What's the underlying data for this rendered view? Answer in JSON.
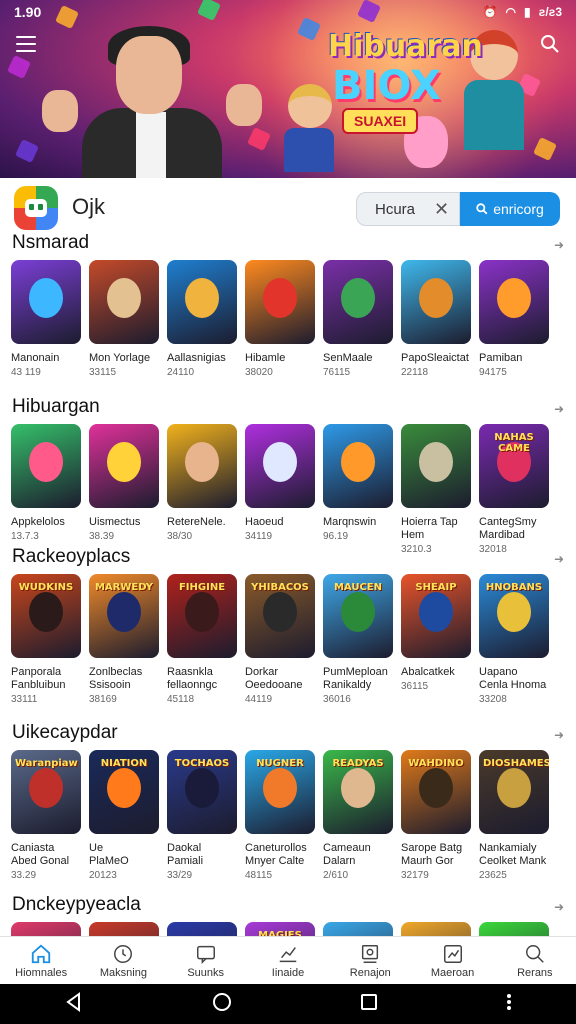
{
  "status_bar": {
    "time": "1.90",
    "battery_text": "ƨ/ƨ3"
  },
  "banner": {
    "logo_line1": "Hibuaran",
    "logo_line2": "BIOX",
    "logo_plate": "SUAXEI"
  },
  "header": {
    "app_name": "Ojk",
    "search_value": "Hcura",
    "search_button_label": "enricorg"
  },
  "sections": [
    {
      "title": "Nsmarad",
      "items": [
        {
          "line1": "Manonain",
          "line2": "",
          "meta": "43 119",
          "art": "",
          "bg": "#7b3fd6",
          "fig": "#3db7ff"
        },
        {
          "line1": "Mon Yorlage",
          "line2": "",
          "meta": "33115",
          "art": "",
          "bg": "#c44a2a",
          "fig": "#e3c190"
        },
        {
          "line1": "Aallasnigias",
          "line2": "",
          "meta": "24110",
          "art": "",
          "bg": "#1f7fd0",
          "fig": "#f0b33e"
        },
        {
          "line1": "Hibamle",
          "line2": "",
          "meta": "38020",
          "art": "",
          "bg": "#ff8a1f",
          "fig": "#e2342a"
        },
        {
          "line1": "SenMaale",
          "line2": "",
          "meta": "76115",
          "art": "",
          "bg": "#7a2fa8",
          "fig": "#3aa655"
        },
        {
          "line1": "PapoSleaictat",
          "line2": "",
          "meta": "22118",
          "art": "",
          "bg": "#3fb8ec",
          "fig": "#e38c2c"
        },
        {
          "line1": "Pamiban",
          "line2": "",
          "meta": "94175",
          "art": "",
          "bg": "#8a32c8",
          "fig": "#ff9c2b"
        }
      ]
    },
    {
      "title": "Hibuargan",
      "items": [
        {
          "line1": "Appkelolos",
          "line2": "",
          "meta": "13.7.3",
          "art": "",
          "bg": "#35c06a",
          "fig": "#ff5a8a"
        },
        {
          "line1": "Uismectus",
          "line2": "",
          "meta": "38.39",
          "art": "",
          "bg": "#e0319a",
          "fig": "#ffd23a"
        },
        {
          "line1": "RetereNele.",
          "line2": "",
          "meta": "38/30",
          "art": "",
          "bg": "#f2b21c",
          "fig": "#e7b48e"
        },
        {
          "line1": "Haoeud",
          "line2": "",
          "meta": "34119",
          "art": "",
          "bg": "#b02fe0",
          "fig": "#dfe8ff"
        },
        {
          "line1": "Marqnswin",
          "line2": "",
          "meta": "96.19",
          "art": "",
          "bg": "#2e9ae8",
          "fig": "#ff9a2a"
        },
        {
          "line1": "Hoierra Tap",
          "line2": "Hem",
          "meta": "3210.3",
          "art": "",
          "bg": "#3a8c3c",
          "fig": "#c8c0a0"
        },
        {
          "line1": "CantegSmy",
          "line2": "Mardibad",
          "meta": "32018",
          "art": "NAHAS CAME",
          "bg": "#7a2ab0",
          "fig": "#e03060"
        }
      ]
    },
    {
      "title": "Rackeoyplacs",
      "items": [
        {
          "line1": "Panporala",
          "line2": "Fanbluibun",
          "meta": "33111",
          "art": "WUDKINS",
          "bg": "#c8461c",
          "fig": "#2a1a1a"
        },
        {
          "line1": "Zonlbeclas",
          "line2": "Ssisooin",
          "meta": "38169",
          "art": "MARWEDY",
          "bg": "#f08a2a",
          "fig": "#1e2a6a"
        },
        {
          "line1": "Raasnkla",
          "line2": "fellaonngc",
          "meta": "45118",
          "art": "FIHGINE",
          "bg": "#b0221c",
          "fig": "#3a1a1a"
        },
        {
          "line1": "Dorkar",
          "line2": "Oeedooane",
          "meta": "44119",
          "art": "YHIBACOS",
          "bg": "#8a5a2a",
          "fig": "#2a2a2a"
        },
        {
          "line1": "PumMeploan",
          "line2": "Ranikaldy",
          "meta": "36016",
          "art": "MAUCEN",
          "bg": "#3fa8e8",
          "fig": "#2a8a3a"
        },
        {
          "line1": "Abalcatkek",
          "line2": "",
          "meta": "36115",
          "art": "SHEAIP",
          "bg": "#e8542a",
          "fig": "#1e4aa0"
        },
        {
          "line1": "Uapano",
          "line2": "Cenla Hnoma",
          "meta": "33208",
          "art": "HNOBANS",
          "bg": "#2a8ad8",
          "fig": "#e8c03a"
        }
      ]
    },
    {
      "title": "Uikecaypdar",
      "items": [
        {
          "line1": "Caniasta",
          "line2": "Abed Gonal",
          "meta": "33.29",
          "art": "Waranpiaw",
          "bg": "#5a6a8a",
          "fig": "#c0302a"
        },
        {
          "line1": "Ue",
          "line2": "PlaMeO",
          "meta": "20123",
          "art": "NIATION",
          "bg": "#1a2a5a",
          "fig": "#ff7a1a"
        },
        {
          "line1": "Daokal",
          "line2": "Pamiali",
          "meta": "33/29",
          "art": "TOCHAOS",
          "bg": "#2a3a8a",
          "fig": "#1a1a3a"
        },
        {
          "line1": "Caneturollos",
          "line2": "Mnyer Calte",
          "meta": "48115",
          "art": "NUGNER",
          "bg": "#2aa8e8",
          "fig": "#f07a2a"
        },
        {
          "line1": "Cameaun",
          "line2": "Dalarn",
          "meta": "2/610",
          "art": "READYAS",
          "bg": "#3ab84a",
          "fig": "#e0b890"
        },
        {
          "line1": "Sarope Batg",
          "line2": "Maurh Gor",
          "meta": "32179",
          "art": "WAHDINO",
          "bg": "#e07a1a",
          "fig": "#3a2a1a"
        },
        {
          "line1": "Nankamialy",
          "line2": "Ceolket Mank",
          "meta": "23625",
          "art": "DIOSHAMES",
          "bg": "#4a3a2a",
          "fig": "#c8a040"
        }
      ]
    },
    {
      "title": "Dnckeypyeacla",
      "items": [
        {
          "line1": "",
          "line2": "",
          "meta": "",
          "art": "",
          "bg": "#e03a6a",
          "fig": "#3a6ad8"
        },
        {
          "line1": "",
          "line2": "",
          "meta": "",
          "art": "",
          "bg": "#c83a2a",
          "fig": "#1a2a5a"
        },
        {
          "line1": "",
          "line2": "",
          "meta": "",
          "art": "",
          "bg": "#2a3aa8",
          "fig": "#3ad8e0"
        },
        {
          "line1": "",
          "line2": "",
          "meta": "",
          "art": "MAGIES",
          "bg": "#a83ad8",
          "fig": "#f0d03a"
        },
        {
          "line1": "",
          "line2": "",
          "meta": "",
          "art": "",
          "bg": "#3aa8e8",
          "fig": "#e0b890"
        },
        {
          "line1": "",
          "line2": "",
          "meta": "",
          "art": "",
          "bg": "#f0a82a",
          "fig": "#c8302a"
        },
        {
          "line1": "",
          "line2": "",
          "meta": "",
          "art": "",
          "bg": "#3ad83a",
          "fig": "#2a8a3a"
        }
      ]
    }
  ],
  "bottom_nav": [
    {
      "label": "Hiomnales",
      "icon": "home-icon",
      "active": true
    },
    {
      "label": "Maksning",
      "icon": "clock-icon",
      "active": false
    },
    {
      "label": "Suunks",
      "icon": "chat-icon",
      "active": false
    },
    {
      "label": "Iinaide",
      "icon": "stats-icon",
      "active": false
    },
    {
      "label": "Renajon",
      "icon": "media-icon",
      "active": false
    },
    {
      "label": "Maeroan",
      "icon": "chart-icon",
      "active": false
    },
    {
      "label": "Rerans",
      "icon": "search-icon",
      "active": false
    }
  ],
  "colors": {
    "accent": "#1a8fe3",
    "nav_bg": "#000000"
  }
}
